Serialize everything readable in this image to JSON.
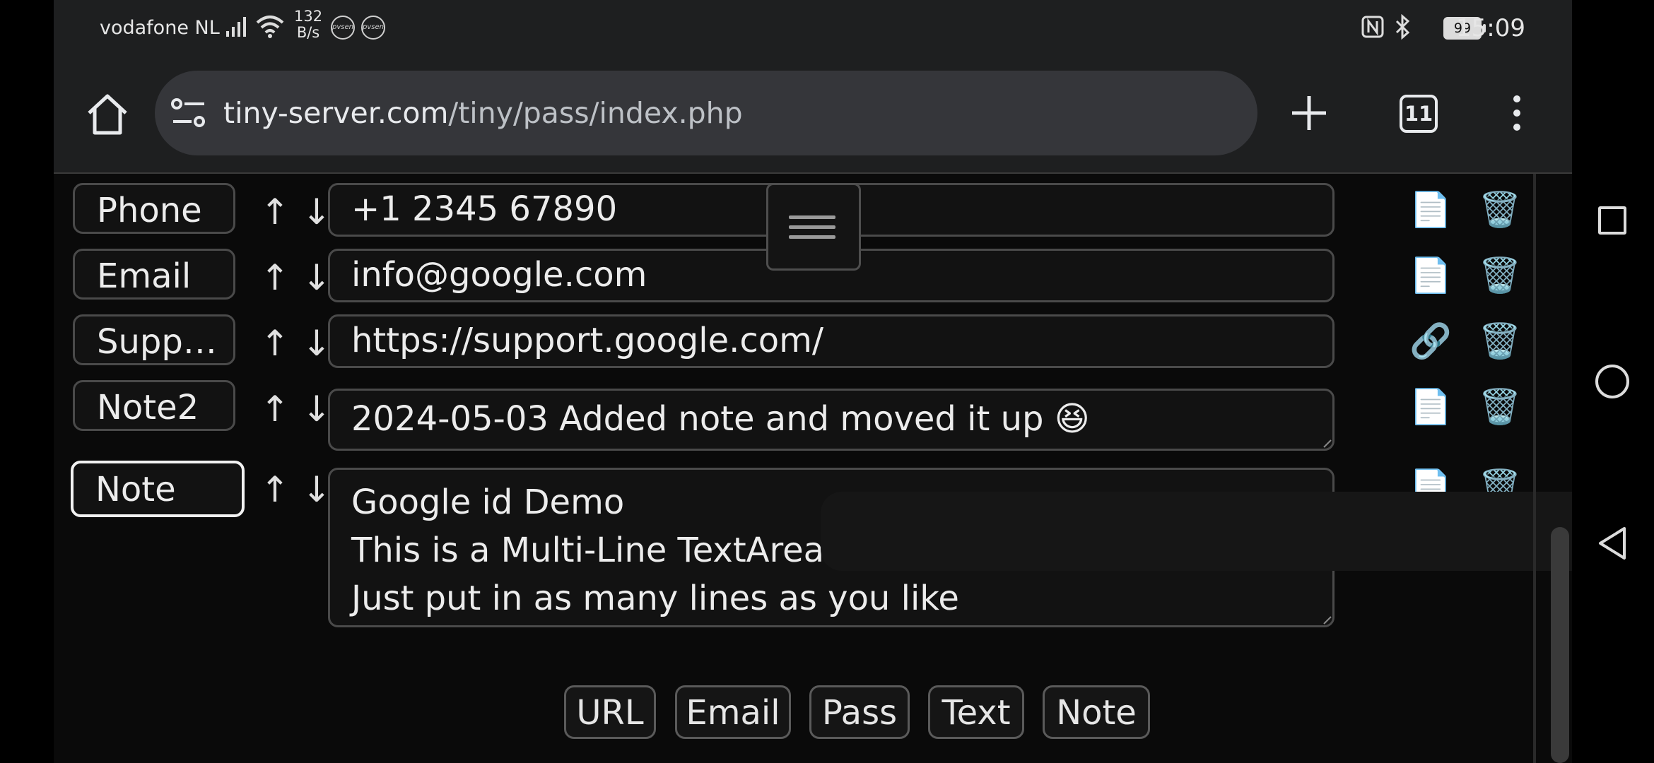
{
  "status_bar": {
    "carrier": "vodafone NL",
    "speed_value": "132",
    "speed_unit": "B/s",
    "notif_badges": [
      "pvsen",
      "pvsen"
    ],
    "battery": "99",
    "time": "15:09",
    "icons": [
      "signal-icon",
      "wifi-icon",
      "nfc-icon",
      "bluetooth-icon",
      "battery-icon"
    ]
  },
  "browser": {
    "url_host": "tiny-server.com",
    "url_path": "/tiny/pass/index.php",
    "tab_count": "11",
    "icons": [
      "home-icon",
      "site-settings-icon",
      "new-tab-icon",
      "tab-switcher-icon",
      "more-menu-icon"
    ]
  },
  "fields": [
    {
      "label": "Phone",
      "value_lines": [
        "+1 2345 67890"
      ],
      "action": "📄"
    },
    {
      "label": "Email",
      "value_lines": [
        "info@google.com"
      ],
      "action": "📄"
    },
    {
      "label": "Supp…",
      "value_lines": [
        "https://support.google.com/"
      ],
      "action": "🔗"
    },
    {
      "label": "Note2",
      "value_lines": [
        "2024-05-03 Added note and moved it up 😆"
      ],
      "action": "📄"
    },
    {
      "label": "Note",
      "value_lines": [
        "Google id Demo",
        "This is a Multi-Line TextArea",
        "Just put in as many lines as you like"
      ],
      "action": "📄"
    }
  ],
  "row_controls": {
    "move_up": "↑",
    "move_down": "↓",
    "delete": "🗑️"
  },
  "add_buttons": [
    "URL",
    "Email",
    "Pass",
    "Text",
    "Note"
  ],
  "colors": {
    "toolbar_bg": "#1e1f20",
    "urlbar_bg": "#35363a",
    "page_bg": "#0a0a0a",
    "border": "#4a4a4a"
  }
}
